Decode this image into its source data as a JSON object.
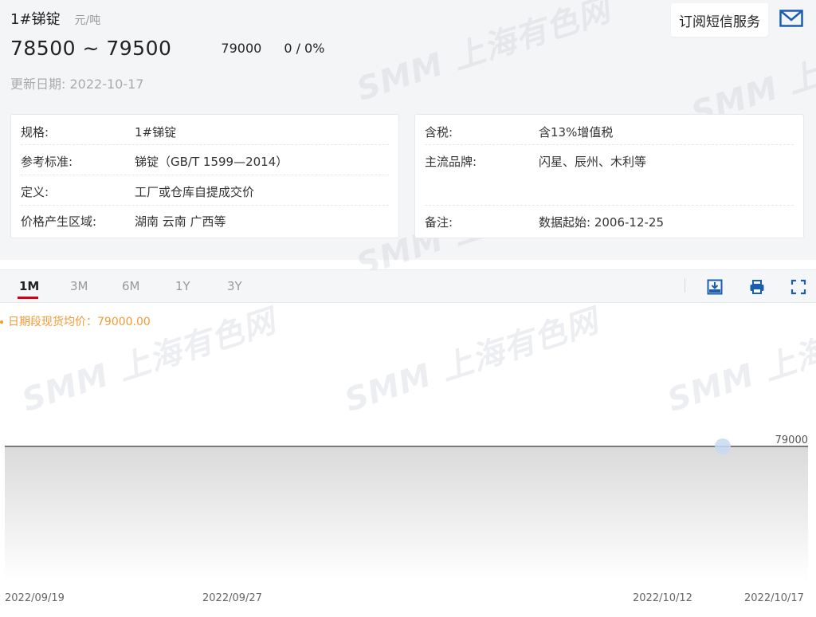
{
  "header": {
    "product_name": "1#锑锭",
    "unit": "元/吨",
    "subscribe_label": "订阅短信服务",
    "price_range": "78500 ~ 79500",
    "average_price": "79000",
    "change": "0 / 0%",
    "update_label": "更新日期: 2022-10-17"
  },
  "watermark_text": "SMM 上海有色网",
  "specs_left": [
    {
      "key": "规格:",
      "value": "1#锑锭"
    },
    {
      "key": "参考标准:",
      "value": "锑锭（GB/T 1599—2014）"
    },
    {
      "key": "定义:",
      "value": "工厂或仓库自提成交价"
    },
    {
      "key": "价格产生区域:",
      "value": "湖南 云南 广西等"
    }
  ],
  "specs_right": [
    {
      "key": "含税:",
      "value": "含13%增值税"
    },
    {
      "key": "主流品牌:",
      "value": "闪星、辰州、木利等"
    },
    {
      "key": "备注:",
      "value": "数据起始: 2006-12-25"
    }
  ],
  "tabs": [
    "1M",
    "3M",
    "6M",
    "1Y",
    "3Y"
  ],
  "active_tab": "1M",
  "toolbar_icons": [
    "download-icon",
    "print-icon",
    "fullscreen-icon"
  ],
  "colors": {
    "accent_red": "#d0021b",
    "legend_orange": "#f39a37",
    "icon_blue": "#1a5eb0",
    "line": "#555555",
    "highlight_point": "#c8daf2"
  },
  "chart_data": {
    "type": "area",
    "legend": "日期段现货均价：79000.00",
    "x": [
      "2022/09/19",
      "2022/09/27",
      "2022/10/12",
      "2022/10/17"
    ],
    "series": [
      {
        "name": "日期段现货均价",
        "values": [
          79000,
          79000,
          79000,
          79000
        ]
      }
    ],
    "y_tick_labels": [
      "79000"
    ],
    "highlighted_point": {
      "x": "2022/10/14",
      "y": 79000
    }
  }
}
